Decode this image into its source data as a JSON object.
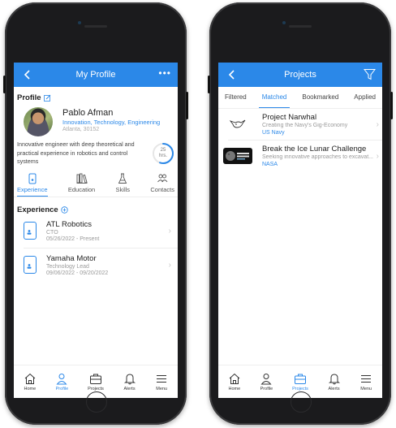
{
  "profile_screen": {
    "title": "My Profile",
    "more": "•••",
    "section_profile": "Profile",
    "name": "Pablo Afman",
    "tags": "Innovation, Technology, Engineering",
    "location": "Atlanta, 30152",
    "bio": "Innovative engineer with deep theoretical and practical experience in robotics and control systems",
    "hours_value": "25",
    "hours_unit": "hrs.",
    "hours_progress": 0.55,
    "tabs": [
      {
        "label": "Experience",
        "icon": "phone-icon"
      },
      {
        "label": "Education",
        "icon": "library-icon"
      },
      {
        "label": "Skills",
        "icon": "flask-icon"
      },
      {
        "label": "Contacts",
        "icon": "people-icon"
      }
    ],
    "section_experience": "Experience",
    "experience": [
      {
        "title": "ATL Robotics",
        "role": "CTO",
        "dates": "05/26/2022 - Present"
      },
      {
        "title": "Yamaha Motor",
        "role": "Technology Lead",
        "dates": "09/06/2022 - 09/20/2022"
      }
    ],
    "active_nav": "Profile"
  },
  "projects_screen": {
    "title": "Projects",
    "tabs": [
      "Filtered",
      "Matched",
      "Bookmarked",
      "Applied"
    ],
    "active_tab": "Matched",
    "projects": [
      {
        "title": "Project Narwhal",
        "subtitle": "Creating the Navy's Gig-Economy",
        "org": "US Navy",
        "logo": "narwhal-logo-icon"
      },
      {
        "title": "Break the Ice Lunar Challenge",
        "subtitle": "Seeking innovative approaches to excavat...",
        "org": "NASA",
        "logo": "break-the-ice-logo-icon"
      }
    ],
    "active_nav": "Projects"
  },
  "bottom_nav": [
    "Home",
    "Profile",
    "Projects",
    "Alerts",
    "Menu"
  ],
  "colors": {
    "accent": "#2b88e8",
    "bezel": "#1b1b1d"
  }
}
